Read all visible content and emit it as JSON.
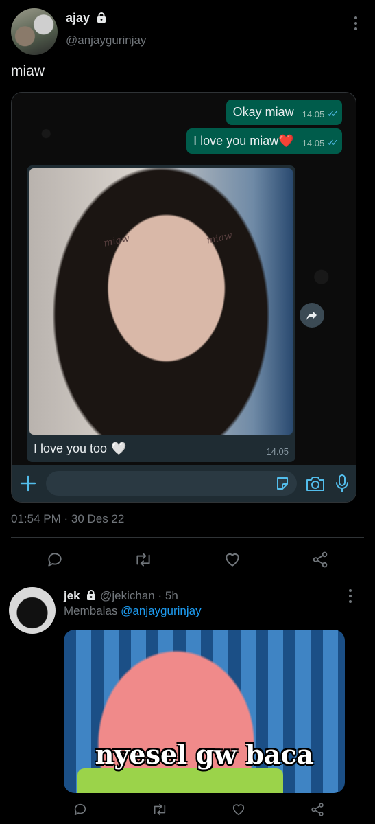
{
  "tweet": {
    "author_name": "ajay",
    "author_handle": "@anjaygurinjay",
    "text": "miaw",
    "timestamp": "01:54 PM · 30 Des 22"
  },
  "chat": {
    "messages": [
      {
        "text": "Okay miaw",
        "time": "14.05"
      },
      {
        "text": "I love you miaw",
        "emoji": "❤️",
        "time": "14.05"
      }
    ],
    "image_message": {
      "caption": "I love you too",
      "emoji": "🤍",
      "time": "14.05",
      "photo_text_1": "miaw",
      "photo_text_2": "miaw"
    }
  },
  "reply": {
    "author_name": "jek",
    "author_handle": "@jekichan",
    "time": "· 5h",
    "replying_to_prefix": "Membalas",
    "replying_to_handle": "@anjaygurinjay",
    "gif_caption": "nyesel gw baca"
  },
  "colors": {
    "background": "#000000",
    "accent": "#1d9bf0",
    "muted": "#71767b",
    "chat_outgoing": "#005c4b"
  }
}
